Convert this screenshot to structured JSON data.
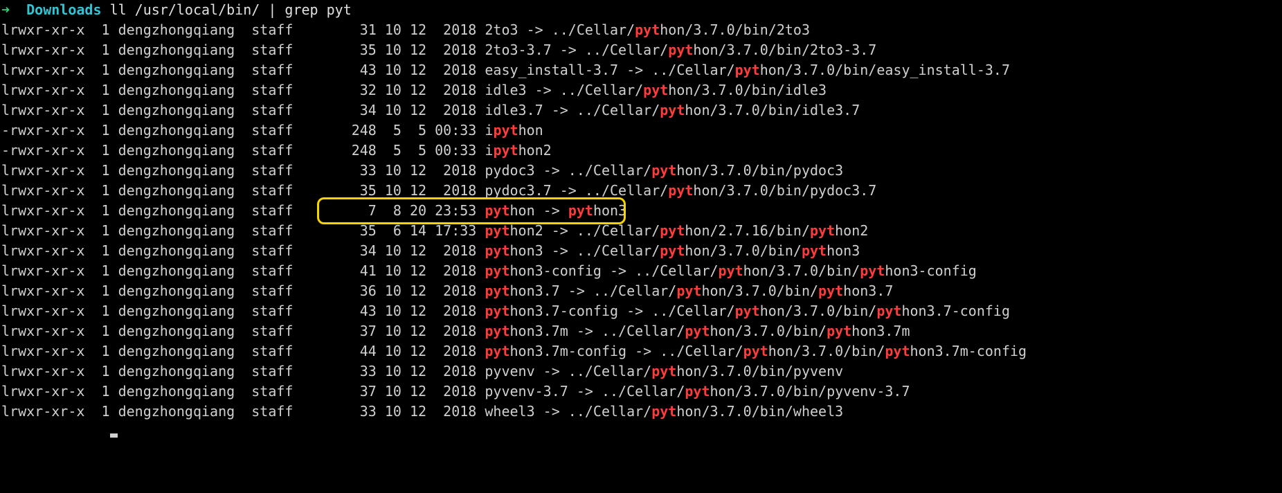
{
  "prompt": {
    "arrow": "➜",
    "cwd": "Downloads",
    "command": "ll /usr/local/bin/ | grep pyt"
  },
  "hl": "pyt",
  "rows": [
    {
      "perm": "lrwxr-xr-x",
      "links": "1",
      "user": "dengzhongqiang",
      "group": "staff",
      "size": "31",
      "m": "10",
      "d": "12",
      "t": "2018",
      "rest": "2to3 -> ../Cellar/python/3.7.0/bin/2to3"
    },
    {
      "perm": "lrwxr-xr-x",
      "links": "1",
      "user": "dengzhongqiang",
      "group": "staff",
      "size": "35",
      "m": "10",
      "d": "12",
      "t": "2018",
      "rest": "2to3-3.7 -> ../Cellar/python/3.7.0/bin/2to3-3.7"
    },
    {
      "perm": "lrwxr-xr-x",
      "links": "1",
      "user": "dengzhongqiang",
      "group": "staff",
      "size": "43",
      "m": "10",
      "d": "12",
      "t": "2018",
      "rest": "easy_install-3.7 -> ../Cellar/python/3.7.0/bin/easy_install-3.7"
    },
    {
      "perm": "lrwxr-xr-x",
      "links": "1",
      "user": "dengzhongqiang",
      "group": "staff",
      "size": "32",
      "m": "10",
      "d": "12",
      "t": "2018",
      "rest": "idle3 -> ../Cellar/python/3.7.0/bin/idle3"
    },
    {
      "perm": "lrwxr-xr-x",
      "links": "1",
      "user": "dengzhongqiang",
      "group": "staff",
      "size": "34",
      "m": "10",
      "d": "12",
      "t": "2018",
      "rest": "idle3.7 -> ../Cellar/python/3.7.0/bin/idle3.7"
    },
    {
      "perm": "-rwxr-xr-x",
      "links": "1",
      "user": "dengzhongqiang",
      "group": "staff",
      "size": "248",
      "m": "5",
      "d": "5",
      "t": "00:33",
      "rest": "ipython"
    },
    {
      "perm": "-rwxr-xr-x",
      "links": "1",
      "user": "dengzhongqiang",
      "group": "staff",
      "size": "248",
      "m": "5",
      "d": "5",
      "t": "00:33",
      "rest": "ipython2"
    },
    {
      "perm": "lrwxr-xr-x",
      "links": "1",
      "user": "dengzhongqiang",
      "group": "staff",
      "size": "33",
      "m": "10",
      "d": "12",
      "t": "2018",
      "rest": "pydoc3 -> ../Cellar/python/3.7.0/bin/pydoc3"
    },
    {
      "perm": "lrwxr-xr-x",
      "links": "1",
      "user": "dengzhongqiang",
      "group": "staff",
      "size": "35",
      "m": "10",
      "d": "12",
      "t": "2018",
      "rest": "pydoc3.7 -> ../Cellar/python/3.7.0/bin/pydoc3.7"
    },
    {
      "perm": "lrwxr-xr-x",
      "links": "1",
      "user": "dengzhongqiang",
      "group": "staff",
      "size": "7",
      "m": "8",
      "d": "20",
      "t": "23:53",
      "rest": "python -> python3",
      "boxed": true
    },
    {
      "perm": "lrwxr-xr-x",
      "links": "1",
      "user": "dengzhongqiang",
      "group": "staff",
      "size": "35",
      "m": "6",
      "d": "14",
      "t": "17:33",
      "rest": "python2 -> ../Cellar/python/2.7.16/bin/python2"
    },
    {
      "perm": "lrwxr-xr-x",
      "links": "1",
      "user": "dengzhongqiang",
      "group": "staff",
      "size": "34",
      "m": "10",
      "d": "12",
      "t": "2018",
      "rest": "python3 -> ../Cellar/python/3.7.0/bin/python3"
    },
    {
      "perm": "lrwxr-xr-x",
      "links": "1",
      "user": "dengzhongqiang",
      "group": "staff",
      "size": "41",
      "m": "10",
      "d": "12",
      "t": "2018",
      "rest": "python3-config -> ../Cellar/python/3.7.0/bin/python3-config"
    },
    {
      "perm": "lrwxr-xr-x",
      "links": "1",
      "user": "dengzhongqiang",
      "group": "staff",
      "size": "36",
      "m": "10",
      "d": "12",
      "t": "2018",
      "rest": "python3.7 -> ../Cellar/python/3.7.0/bin/python3.7"
    },
    {
      "perm": "lrwxr-xr-x",
      "links": "1",
      "user": "dengzhongqiang",
      "group": "staff",
      "size": "43",
      "m": "10",
      "d": "12",
      "t": "2018",
      "rest": "python3.7-config -> ../Cellar/python/3.7.0/bin/python3.7-config"
    },
    {
      "perm": "lrwxr-xr-x",
      "links": "1",
      "user": "dengzhongqiang",
      "group": "staff",
      "size": "37",
      "m": "10",
      "d": "12",
      "t": "2018",
      "rest": "python3.7m -> ../Cellar/python/3.7.0/bin/python3.7m"
    },
    {
      "perm": "lrwxr-xr-x",
      "links": "1",
      "user": "dengzhongqiang",
      "group": "staff",
      "size": "44",
      "m": "10",
      "d": "12",
      "t": "2018",
      "rest": "python3.7m-config -> ../Cellar/python/3.7.0/bin/python3.7m-config"
    },
    {
      "perm": "lrwxr-xr-x",
      "links": "1",
      "user": "dengzhongqiang",
      "group": "staff",
      "size": "33",
      "m": "10",
      "d": "12",
      "t": "2018",
      "rest": "pyvenv -> ../Cellar/python/3.7.0/bin/pyvenv"
    },
    {
      "perm": "lrwxr-xr-x",
      "links": "1",
      "user": "dengzhongqiang",
      "group": "staff",
      "size": "37",
      "m": "10",
      "d": "12",
      "t": "2018",
      "rest": "pyvenv-3.7 -> ../Cellar/python/3.7.0/bin/pyvenv-3.7"
    },
    {
      "perm": "lrwxr-xr-x",
      "links": "1",
      "user": "dengzhongqiang",
      "group": "staff",
      "size": "33",
      "m": "10",
      "d": "12",
      "t": "2018",
      "rest": "wheel3 -> ../Cellar/python/3.7.0/bin/wheel3"
    }
  ]
}
